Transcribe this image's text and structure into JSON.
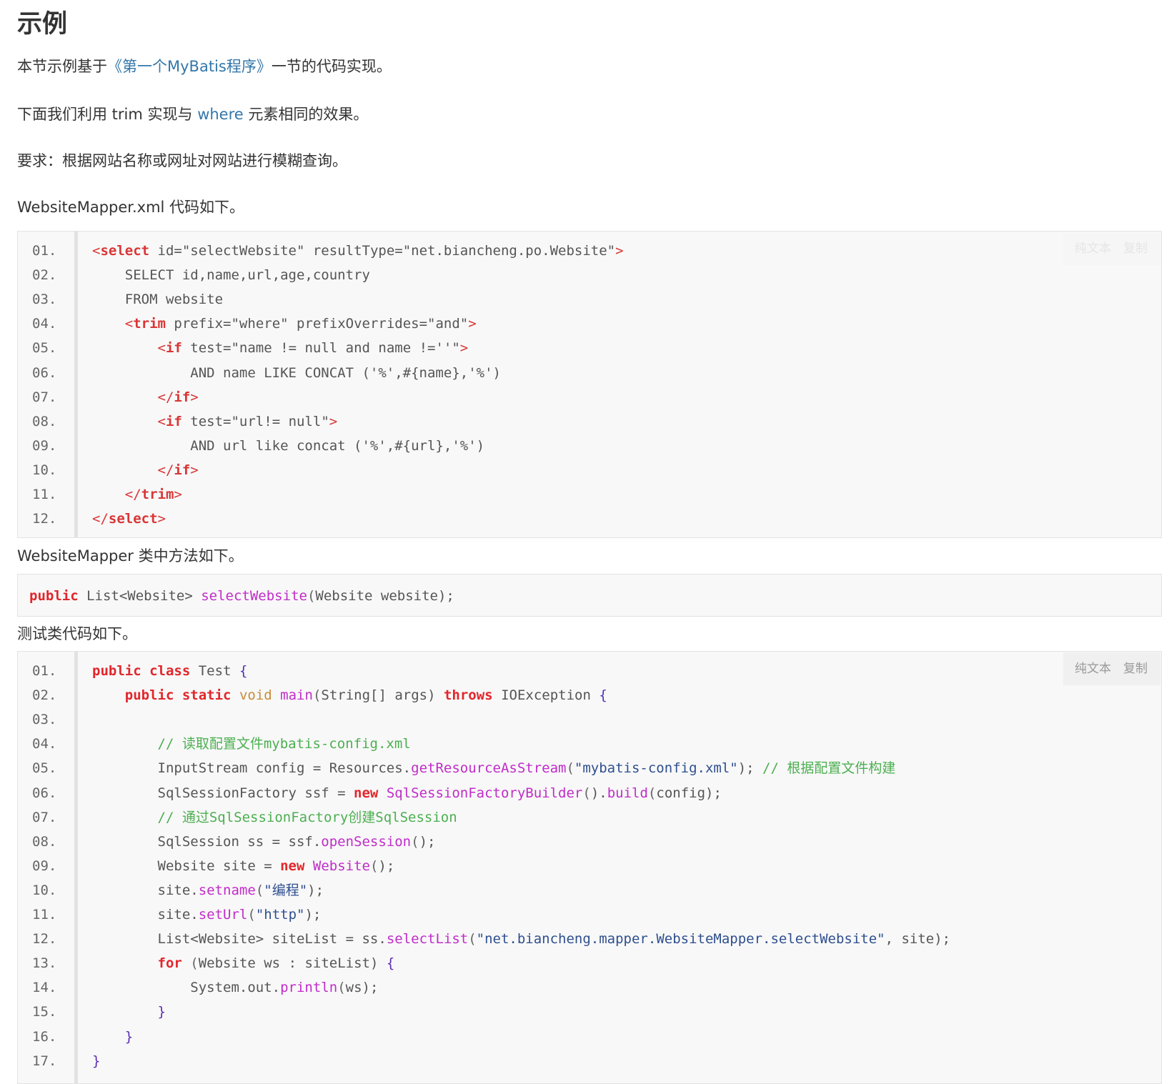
{
  "heading": "示例",
  "intro": {
    "before": "本节示例基于",
    "link": "《第一个MyBatis程序》",
    "after": "一节的代码实现。"
  },
  "trim_sentence": {
    "before": "下面我们利用 trim 实现与 ",
    "link": "where",
    "after": " 元素相同的效果。"
  },
  "requirement": "要求：根据网站名称或网址对网站进行模糊查询。",
  "xml_caption": "WebsiteMapper.xml 代码如下。",
  "mapper_caption": "WebsiteMapper 类中方法如下。",
  "test_caption": "测试类代码如下。",
  "toolbar": {
    "plain_text": "纯文本",
    "copy": "复制"
  },
  "xml_code": {
    "line_numbers": [
      "01.",
      "02.",
      "03.",
      "04.",
      "05.",
      "06.",
      "07.",
      "08.",
      "09.",
      "10.",
      "11.",
      "12."
    ],
    "lines": [
      "<select id=\"selectWebsite\" resultType=\"net.biancheng.po.Website\">",
      "    SELECT id,name,url,age,country",
      "    FROM website",
      "    <trim prefix=\"where\" prefixOverrides=\"and\">",
      "        <if test=\"name != null and name !=''\">",
      "            AND name LIKE CONCAT ('%',#{name},'%')",
      "        </if>",
      "        <if test=\"url!= null\">",
      "            AND url like concat ('%',#{url},'%')",
      "        </if>",
      "    </trim>",
      "</select>"
    ]
  },
  "mapper_code": {
    "line": "public List<Website> selectWebsite(Website website);"
  },
  "test_code": {
    "line_numbers": [
      "01.",
      "02.",
      "03.",
      "04.",
      "05.",
      "06.",
      "07.",
      "08.",
      "09.",
      "10.",
      "11.",
      "12.",
      "13.",
      "14.",
      "15.",
      "16.",
      "17."
    ],
    "lines": [
      "public class Test {",
      "    public static void main(String[] args) throws IOException {",
      "",
      "        // 读取配置文件mybatis-config.xml",
      "        InputStream config = Resources.getResourceAsStream(\"mybatis-config.xml\"); // 根据配置文件构建",
      "        SqlSessionFactory ssf = new SqlSessionFactoryBuilder().build(config);",
      "        // 通过SqlSessionFactory创建SqlSession",
      "        SqlSession ss = ssf.openSession();",
      "        Website site = new Website();",
      "        site.setname(\"编程\");",
      "        site.setUrl(\"http\");",
      "        List<Website> siteList = ss.selectList(\"net.biancheng.mapper.WebsiteMapper.selectWebsite\", site);",
      "        for (Website ws : siteList) {",
      "            System.out.println(ws);",
      "        }",
      "    }",
      "}"
    ]
  },
  "colors": {
    "link": "#3377aa",
    "keyword": "#e2262b",
    "tag": "#d93636",
    "attribute": "#c88b3a",
    "function": "#c02cc9",
    "comment": "#4caf50",
    "code_background": "#f8f8f8"
  }
}
